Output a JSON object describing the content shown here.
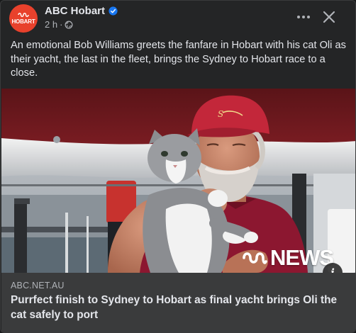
{
  "post": {
    "page_name": "ABC Hobart",
    "avatar_text": "HOBART",
    "time": "2 h",
    "separator": "·",
    "text": "An emotional Bob Williams greets the fanfare in Hobart with his cat Oli as their yacht, the last in the fleet, brings the Sydney to Hobart race to a close."
  },
  "icons": {
    "verified": "verified-badge-icon",
    "privacy": "globe-icon",
    "more": "more-options-icon",
    "close": "close-icon",
    "info": "info-icon"
  },
  "media": {
    "watermark": "NEWS",
    "info_glyph": "i"
  },
  "link_preview": {
    "domain": "ABC.NET.AU",
    "headline": "Purrfect finish to Sydney to Hobart as final yacht brings Oli the cat safely to port"
  },
  "colors": {
    "background": "#242526",
    "link_box": "#3a3b3c",
    "primary_text": "#e4e6eb",
    "secondary_text": "#b0b3b8",
    "verified_blue": "#1877f2",
    "avatar_red": "#e8412c"
  }
}
